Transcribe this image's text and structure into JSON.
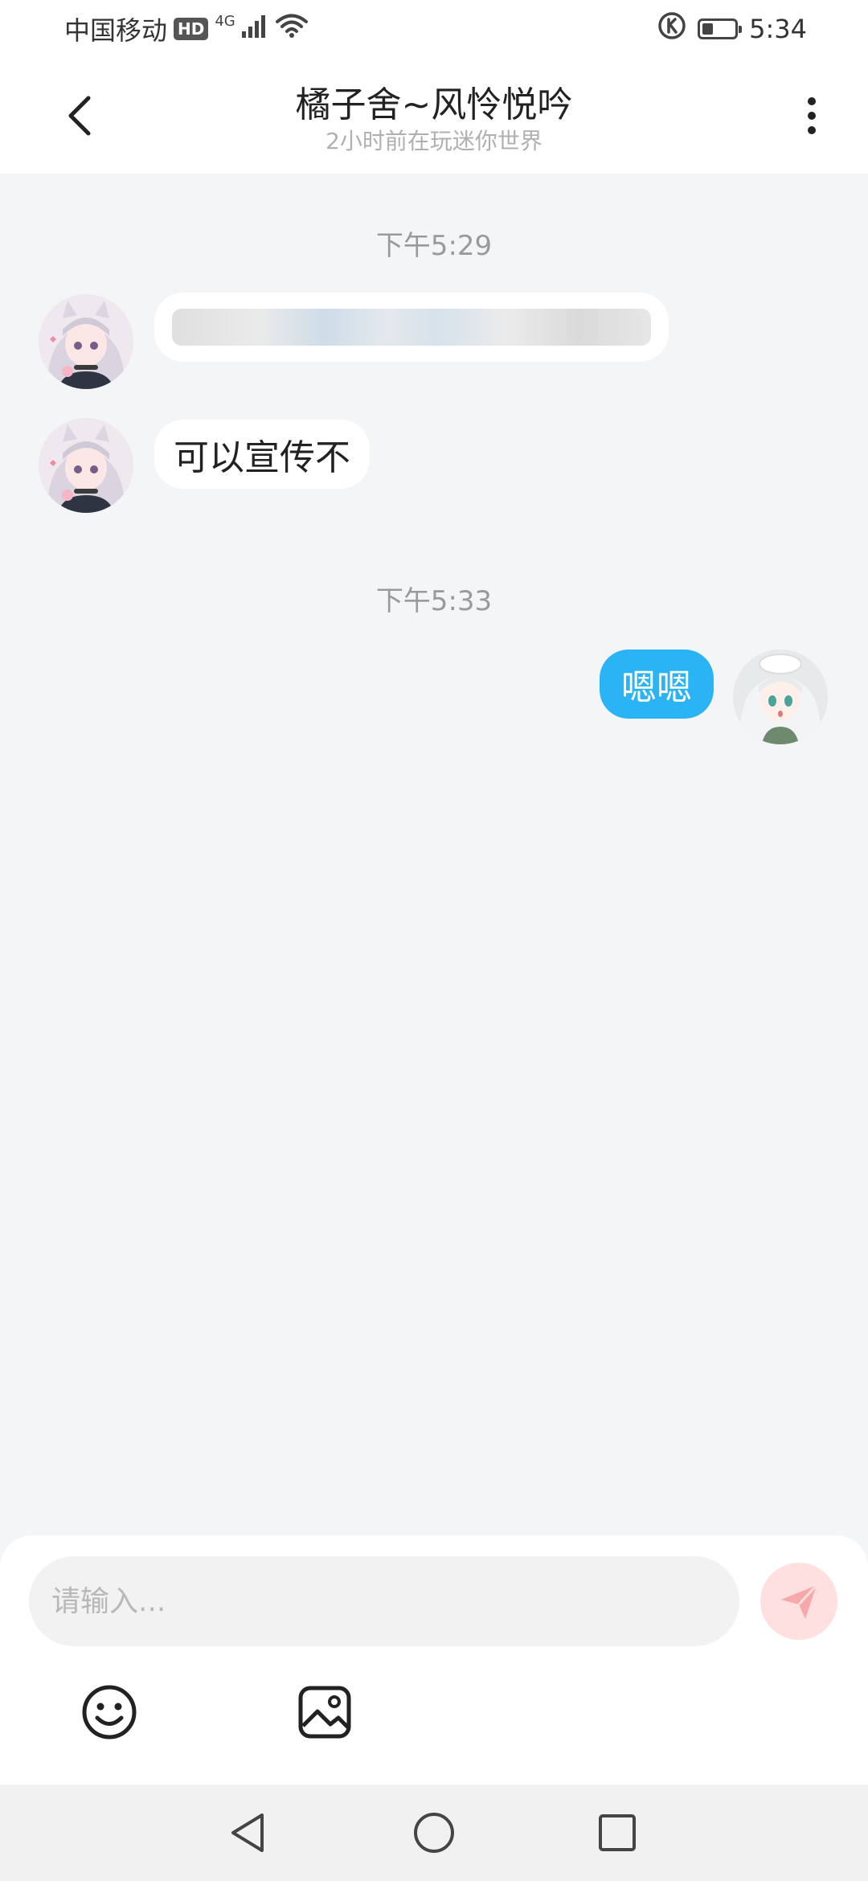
{
  "status_bar": {
    "carrier": "中国移动",
    "hd_badge": "HD",
    "network": "4G",
    "time": "5:34",
    "battery_level": 0.35
  },
  "header": {
    "title": "橘子舍~风怜悦吟",
    "subtitle": "2小时前在玩迷你世界",
    "back_icon": "chevron-left-icon",
    "more_icon": "more-vertical-icon"
  },
  "chat": {
    "time_1": "下午5:29",
    "messages_1": [
      {
        "sender": "other",
        "text": "",
        "redacted": true
      },
      {
        "sender": "other",
        "text": "可以宣传不"
      }
    ],
    "time_2": "下午5:33",
    "messages_2": [
      {
        "sender": "me",
        "text": "嗯嗯"
      }
    ]
  },
  "input": {
    "placeholder": "请输入...",
    "value": "",
    "send_icon": "paper-plane-icon",
    "emoji_icon": "smiley-icon",
    "image_icon": "image-icon"
  },
  "nav": {
    "back_icon": "triangle-back-icon",
    "home_icon": "circle-home-icon",
    "recents_icon": "square-recents-icon"
  },
  "colors": {
    "accent_blue": "#2ab4f5",
    "chat_background": "#f4f5f7",
    "send_button_bg": "#ffe0e0"
  }
}
